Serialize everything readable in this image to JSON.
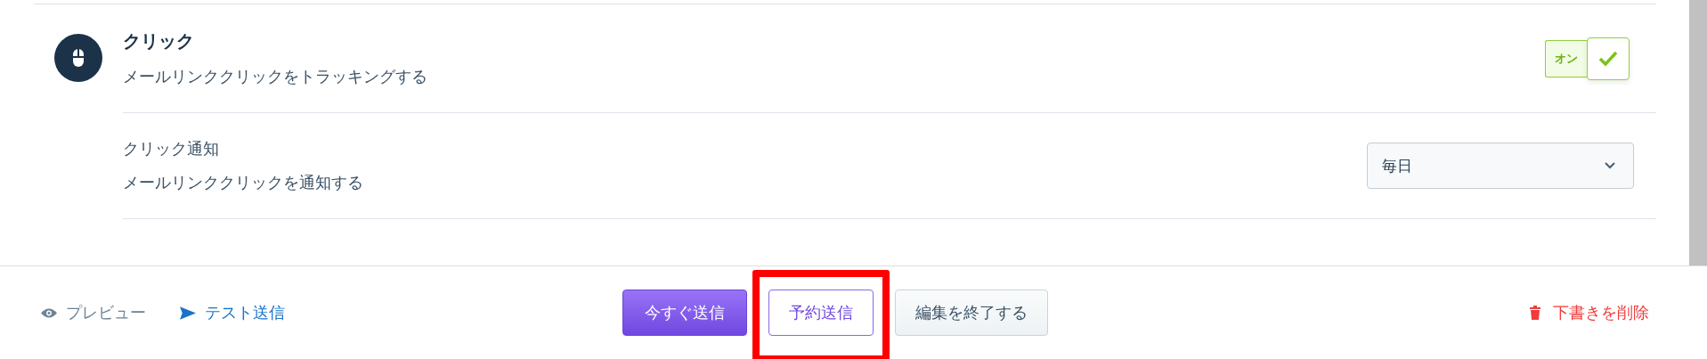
{
  "setting": {
    "title": "クリック",
    "description": "メールリンククリックをトラッキングする",
    "toggle": {
      "label": "オン",
      "on": true
    }
  },
  "notification": {
    "title": "クリック通知",
    "description": "メールリンククリックを通知する",
    "select": {
      "value": "毎日"
    }
  },
  "footer": {
    "links": [
      {
        "kind": "preview",
        "label": "プレビュー"
      },
      {
        "kind": "test",
        "label": "テスト送信"
      }
    ],
    "buttons": [
      {
        "kind": "primary",
        "label": "今すぐ送信",
        "highlighted": false
      },
      {
        "kind": "outline",
        "label": "予約送信",
        "highlighted": true
      },
      {
        "kind": "plain",
        "label": "編集を終了する",
        "highlighted": false
      }
    ],
    "delete": {
      "label": "下書きを削除"
    }
  }
}
